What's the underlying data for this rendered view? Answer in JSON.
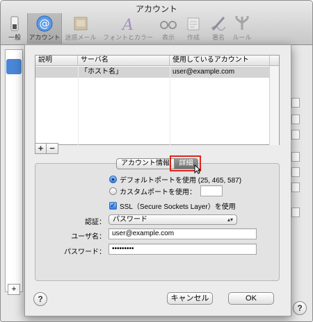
{
  "window": {
    "title": "アカウント"
  },
  "toolbar": {
    "items": [
      {
        "label": "一般",
        "icon": "switch-icon"
      },
      {
        "label": "アカウント",
        "icon": "at-sign-icon",
        "selected": true
      },
      {
        "label": "迷惑メール",
        "icon": "junk-mail-icon"
      },
      {
        "label": "フォントとカラー",
        "icon": "font-color-icon"
      },
      {
        "label": "表示",
        "icon": "glasses-icon"
      },
      {
        "label": "作成",
        "icon": "compose-icon"
      },
      {
        "label": "署名",
        "icon": "signature-pen-icon"
      },
      {
        "label": "ルール",
        "icon": "rules-icon"
      }
    ]
  },
  "server_table": {
    "columns": [
      "説明",
      "サーバ名",
      "使用しているアカウント"
    ],
    "rows": [
      {
        "description": "",
        "server": "「ホスト名」",
        "account": "user@example.com"
      }
    ]
  },
  "table_buttons": {
    "add": "+",
    "remove": "−"
  },
  "tabs": {
    "account_info": "アカウント情報",
    "advanced": "詳細",
    "selected": "詳細"
  },
  "port": {
    "default_label": "デフォルトポートを使用 (25, 465, 587)",
    "custom_label": "カスタムポートを使用：",
    "selected": "default",
    "custom_value": ""
  },
  "ssl": {
    "label": "SSL（Secure Sockets Layer）を使用",
    "checked": true
  },
  "auth": {
    "label": "認証：",
    "value": "パスワード"
  },
  "username": {
    "label": "ユーザ名：",
    "value": "user@example.com"
  },
  "password": {
    "label": "パスワード：",
    "value": "•••••••••"
  },
  "buttons": {
    "help": "?",
    "cancel": "キャンセル",
    "ok": "OK"
  },
  "background": {
    "add": "+",
    "help": "?"
  },
  "colors": {
    "highlight": "#e2231a",
    "selection_row": "#d4d4d4",
    "radio_blue": "#2f7ce0"
  }
}
